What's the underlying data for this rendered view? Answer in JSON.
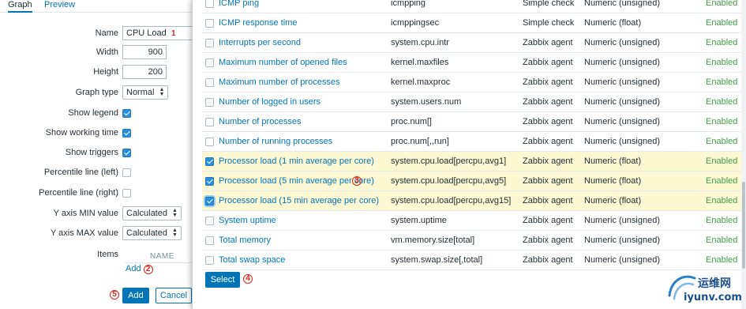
{
  "tabs": {
    "graph": "Graph",
    "preview": "Preview"
  },
  "form": {
    "name_label": "Name",
    "name_value": "CPU Load",
    "name_marker": "1",
    "width_label": "Width",
    "width_value": "900",
    "height_label": "Height",
    "height_value": "200",
    "graph_type_label": "Graph type",
    "graph_type_value": "Normal",
    "show_legend_label": "Show legend",
    "show_legend": true,
    "show_working_time_label": "Show working time",
    "show_working_time": true,
    "show_triggers_label": "Show triggers",
    "show_triggers": true,
    "percentile_left_label": "Percentile line (left)",
    "percentile_left": false,
    "percentile_right_label": "Percentile line (right)",
    "percentile_right": false,
    "y_min_label": "Y axis MIN value",
    "y_min_value": "Calculated",
    "y_max_label": "Y axis MAX value",
    "y_max_value": "Calculated",
    "items_label": "Items",
    "items_name_header": "NAME",
    "add_link": "Add",
    "add_marker": "2",
    "add_button": "Add",
    "add_button_marker": "5",
    "cancel_button": "Cancel"
  },
  "popup": {
    "rows": [
      {
        "name": "ICMP ping",
        "key": "icmpping",
        "type": "Simple check",
        "value_type": "Numeric (unsigned)",
        "status": "Enabled",
        "checked": false
      },
      {
        "name": "ICMP response time",
        "key": "icmppingsec",
        "type": "Simple check",
        "value_type": "Numeric (float)",
        "status": "Enabled",
        "checked": false
      },
      {
        "name": "Interrupts per second",
        "key": "system.cpu.intr",
        "type": "Zabbix agent",
        "value_type": "Numeric (unsigned)",
        "status": "Enabled",
        "checked": false
      },
      {
        "name": "Maximum number of opened files",
        "key": "kernel.maxfiles",
        "type": "Zabbix agent",
        "value_type": "Numeric (unsigned)",
        "status": "Enabled",
        "checked": false
      },
      {
        "name": "Maximum number of processes",
        "key": "kernel.maxproc",
        "type": "Zabbix agent",
        "value_type": "Numeric (unsigned)",
        "status": "Enabled",
        "checked": false
      },
      {
        "name": "Number of logged in users",
        "key": "system.users.num",
        "type": "Zabbix agent",
        "value_type": "Numeric (unsigned)",
        "status": "Enabled",
        "checked": false
      },
      {
        "name": "Number of processes",
        "key": "proc.num[]",
        "type": "Zabbix agent",
        "value_type": "Numeric (unsigned)",
        "status": "Enabled",
        "checked": false
      },
      {
        "name": "Number of running processes",
        "key": "proc.num[,,run]",
        "type": "Zabbix agent",
        "value_type": "Numeric (unsigned)",
        "status": "Enabled",
        "checked": false
      },
      {
        "name": "Processor load (1 min average per core)",
        "key": "system.cpu.load[percpu,avg1]",
        "type": "Zabbix agent",
        "value_type": "Numeric (float)",
        "status": "Enabled",
        "checked": true
      },
      {
        "name": "Processor load (5 min average per core)",
        "key": "system.cpu.load[percpu,avg5]",
        "type": "Zabbix agent",
        "value_type": "Numeric (float)",
        "status": "Enabled",
        "checked": true
      },
      {
        "name": "Processor load (15 min average per core)",
        "key": "system.cpu.load[percpu,avg15]",
        "type": "Zabbix agent",
        "value_type": "Numeric (float)",
        "status": "Enabled",
        "checked": true
      },
      {
        "name": "System uptime",
        "key": "system.uptime",
        "type": "Zabbix agent",
        "value_type": "Numeric (unsigned)",
        "status": "Enabled",
        "checked": false
      },
      {
        "name": "Total memory",
        "key": "vm.memory.size[total]",
        "type": "Zabbix agent",
        "value_type": "Numeric (unsigned)",
        "status": "Enabled",
        "checked": false
      },
      {
        "name": "Total swap space",
        "key": "system.swap.size[,total]",
        "type": "Zabbix agent",
        "value_type": "Numeric (unsigned)",
        "status": "Enabled",
        "checked": false
      }
    ],
    "selected_marker": "3",
    "select_button": "Select",
    "select_marker": "4"
  },
  "watermark": {
    "text": "运维网",
    "url": "iyunv.com"
  },
  "colors": {
    "link": "#0275b8",
    "enabled": "#429e47",
    "selected_row": "#fbf8d2",
    "marker": "#e2231a"
  }
}
